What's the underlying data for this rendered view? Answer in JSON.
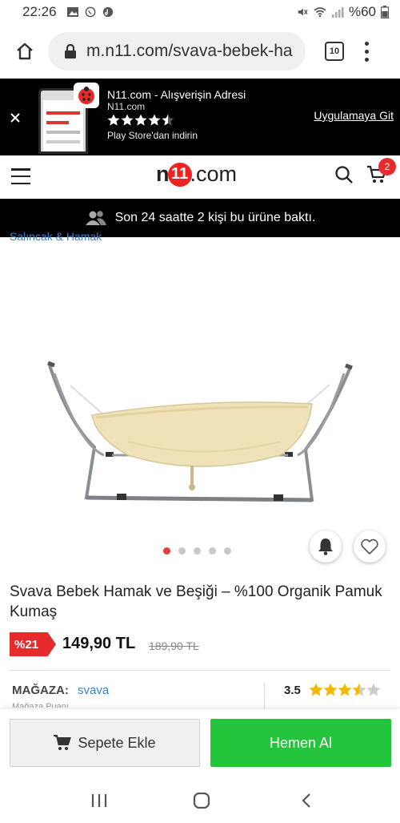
{
  "status_bar": {
    "time": "22:26",
    "battery": "%60"
  },
  "browser": {
    "url": "m.n11.com/svava-bebek-ha",
    "tab_count": "10"
  },
  "app_banner": {
    "title": "N11.com - Alışverişin Adresi",
    "subtitle": "N11.com",
    "store_text": "Play Store'dan indirin",
    "cta": "Uygulamaya Git",
    "rating_stars": 4.5
  },
  "header": {
    "logo_n": "n",
    "logo_11": "11",
    "logo_com": ".com",
    "cart_count": "2"
  },
  "notice": {
    "text": "Son 24 saatte 2 kişi bu ürüne baktı."
  },
  "breadcrumb": {
    "text": "Salıncak & Hamak"
  },
  "gallery": {
    "image_count": 5,
    "active_index": 0
  },
  "product": {
    "title": "Svava Bebek Hamak ve Beşiği – %100 Organik Pamuk Kumaş",
    "discount": "%21",
    "price": "149,90 TL",
    "old_price": "189,90 TL"
  },
  "store": {
    "label": "MAĞAZA:",
    "name": "svava",
    "sub": "Mağaza Puanı",
    "rating": "3.5"
  },
  "actions": {
    "add_to_cart": "Sepete Ekle",
    "buy_now": "Hemen Al"
  },
  "colors": {
    "accent_red": "#e52b2b",
    "buy_green": "#25c43d",
    "link_blue": "#3b7fd1",
    "star_yellow": "#f5b800"
  }
}
